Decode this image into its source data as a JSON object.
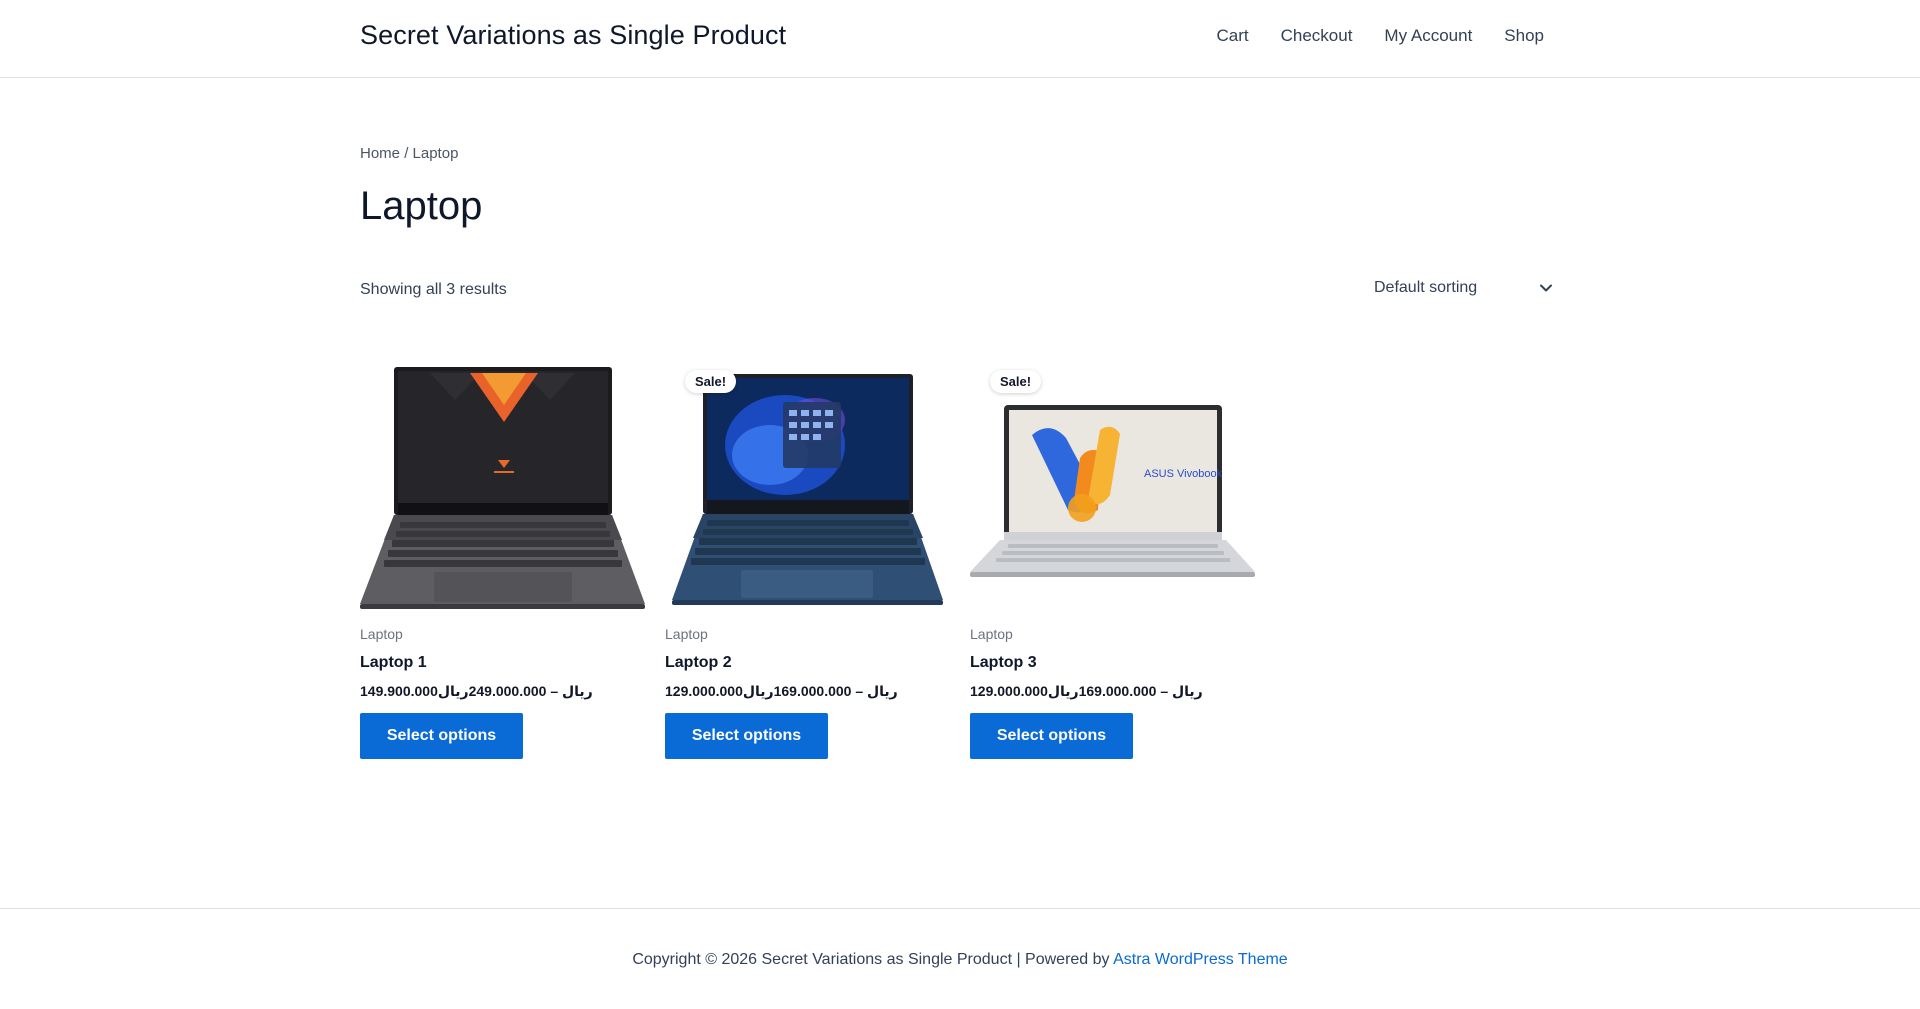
{
  "header": {
    "site_title": "Secret Variations as Single Product",
    "nav": [
      {
        "label": "Cart"
      },
      {
        "label": "Checkout"
      },
      {
        "label": "My Account"
      },
      {
        "label": "Shop"
      }
    ]
  },
  "breadcrumb": {
    "home": "Home",
    "separator": "/",
    "current": "Laptop"
  },
  "page": {
    "title": "Laptop",
    "result_count": "Showing all 3 results",
    "ordering": {
      "selected": "Default sorting",
      "icon": "chevron-down-icon"
    }
  },
  "products": [
    {
      "category": "Laptop",
      "title": "Laptop 1",
      "price": "149.900.000ریال – 249.000.000ریال",
      "sale_badge": "",
      "button_label": "Select options",
      "image": "laptop-image-dark-gray"
    },
    {
      "category": "Laptop",
      "title": "Laptop 2",
      "price": "129.000.000ریال – 169.000.000ریال",
      "sale_badge": "Sale!",
      "button_label": "Select options",
      "image": "laptop-image-blue"
    },
    {
      "category": "Laptop",
      "title": "Laptop 3",
      "price": "129.000.000ریال – 169.000.000ریال",
      "sale_badge": "Sale!",
      "button_label": "Select options",
      "image": "laptop-image-silver",
      "screen_text": "ASUS Vivobook"
    }
  ],
  "footer": {
    "text": "Copyright © 2026 Secret Variations as Single Product | Powered by",
    "link_label": "Astra WordPress Theme"
  },
  "colors": {
    "accent": "#0a6ad6",
    "heading": "#0f172a",
    "body_text": "#334155",
    "border": "#dcdfe3"
  }
}
